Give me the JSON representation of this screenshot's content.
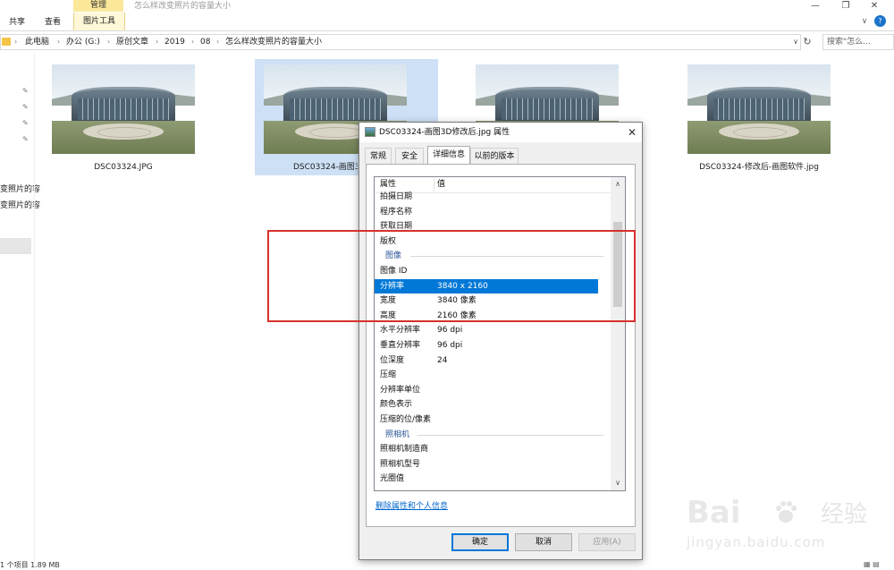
{
  "window": {
    "title": "怎么样改变照片的容量大小",
    "context_tab": "管理",
    "controls": [
      "—",
      "❐",
      "✕"
    ]
  },
  "ribbon": {
    "tabs": [
      "共享",
      "查看"
    ],
    "picture_tools": "图片工具",
    "caret": "∨",
    "help": "?"
  },
  "address": {
    "crumbs": [
      "此电脑",
      "办公 (G:)",
      "原创文章",
      "2019",
      "08",
      "怎么样改变照片的容量大小"
    ],
    "search_placeholder": "搜索\"怎么..."
  },
  "nav": {
    "items": [
      "变照片的容",
      "变照片的容"
    ]
  },
  "files": [
    {
      "name": "DSC03324.JPG"
    },
    {
      "name": "DSC03324-画图3D修改后.jpg"
    },
    {
      "name": ""
    },
    {
      "name": "DSC03324-修改后-画图软件.jpg"
    }
  ],
  "status": {
    "text": "1 个项目  1.89 MB"
  },
  "dialog": {
    "title": "DSC03324-画图3D修改后.jpg 属性",
    "tabs": [
      "常规",
      "安全",
      "详细信息",
      "以前的版本"
    ],
    "active_tab": "详细信息",
    "columns": {
      "property": "属性",
      "value": "值"
    },
    "rows": [
      {
        "k": "拍摄日期",
        "v": ""
      },
      {
        "k": "程序名称",
        "v": ""
      },
      {
        "k": "获取日期",
        "v": ""
      },
      {
        "k": "版权",
        "v": ""
      },
      {
        "k": "图像",
        "v": "",
        "group": true
      },
      {
        "k": "图像 ID",
        "v": ""
      },
      {
        "k": "分辨率",
        "v": "3840 x 2160",
        "selected": true
      },
      {
        "k": "宽度",
        "v": "3840 像素"
      },
      {
        "k": "高度",
        "v": "2160 像素"
      },
      {
        "k": "水平分辨率",
        "v": "96 dpi"
      },
      {
        "k": "垂直分辨率",
        "v": "96 dpi"
      },
      {
        "k": "位深度",
        "v": "24"
      },
      {
        "k": "压缩",
        "v": ""
      },
      {
        "k": "分辨率单位",
        "v": ""
      },
      {
        "k": "颜色表示",
        "v": ""
      },
      {
        "k": "压缩的位/像素",
        "v": ""
      },
      {
        "k": "照相机",
        "v": "",
        "group": true
      },
      {
        "k": "照相机制造商",
        "v": ""
      },
      {
        "k": "照相机型号",
        "v": ""
      },
      {
        "k": "光圈值",
        "v": ""
      }
    ],
    "remove_link": "删除属性和个人信息",
    "buttons": {
      "ok": "确定",
      "cancel": "取消",
      "apply": "应用(A)"
    }
  },
  "watermark": {
    "brand": "Bai",
    "brand_cn": "经验",
    "url": "jingyan.baidu.com"
  }
}
